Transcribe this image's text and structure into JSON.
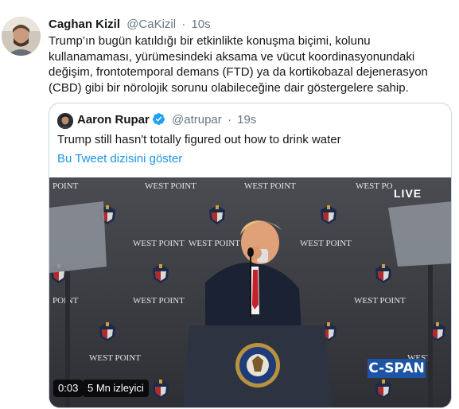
{
  "tweet": {
    "author_name": "Caghan Kizil",
    "author_handle": "@CaKizil",
    "separator": "·",
    "timestamp": "10s",
    "text": "Trump’ın bugün katıldığı bir etkinlikte konuşma biçimi, kolunu kullanamaması, yürümesindeki aksama ve vücut koordinasyonundaki değişim, frontotemporal demans (FTD) ya da kortikobazal dejenerasyon (CBD) gibi bir nörolojik sorunu olabileceğine dair göstergelere sahip."
  },
  "quoted_tweet": {
    "author_name": "Aaron Rupar",
    "author_handle": "@atrupar",
    "separator": "·",
    "timestamp": "19s",
    "verified": true,
    "text": "Trump still hasn't totally figured out how to drink water",
    "thread_link": "Bu Tweet dizisini göster"
  },
  "video": {
    "live_badge": "LIVE",
    "network_logo": "C-SPAN",
    "elapsed": "0:03",
    "views": "5 Mn izleyici",
    "backdrop_text": "WEST POINT"
  },
  "colors": {
    "link": "#1b95e0",
    "verified": "#1da1f2",
    "muted": "#657786",
    "cspan_blue": "#1c55a6"
  }
}
